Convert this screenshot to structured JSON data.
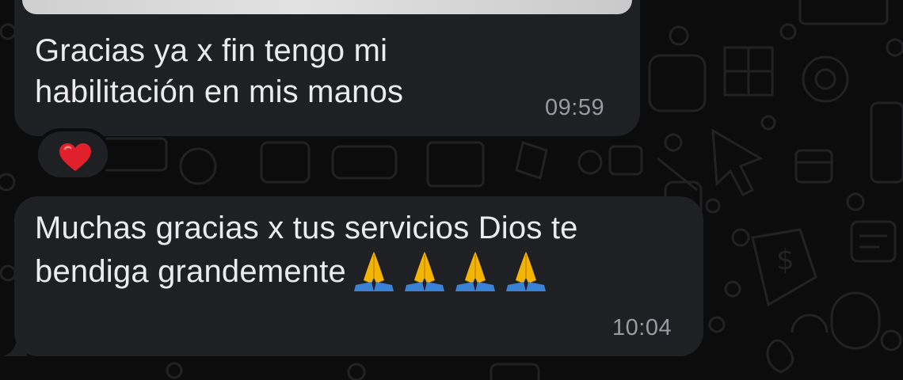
{
  "messages": [
    {
      "text": "Gracias ya x fin tengo mi\nhabilitación en mis manos",
      "time": "09:59",
      "reaction": "heart-icon"
    },
    {
      "text": "Muchas gracias x tus servicios Dios te\nbendiga grandemente",
      "emoji": [
        "folded-hands-icon",
        "folded-hands-icon",
        "folded-hands-icon",
        "folded-hands-icon"
      ],
      "time": "10:04"
    }
  ],
  "colors": {
    "background": "#0c0c0c",
    "bubble": "#1f2023",
    "text": "#ececee",
    "time": "#9a9aa0",
    "heart": "#e0202a",
    "prayer": "#f4b400",
    "sleeve": "#3b82d6"
  }
}
